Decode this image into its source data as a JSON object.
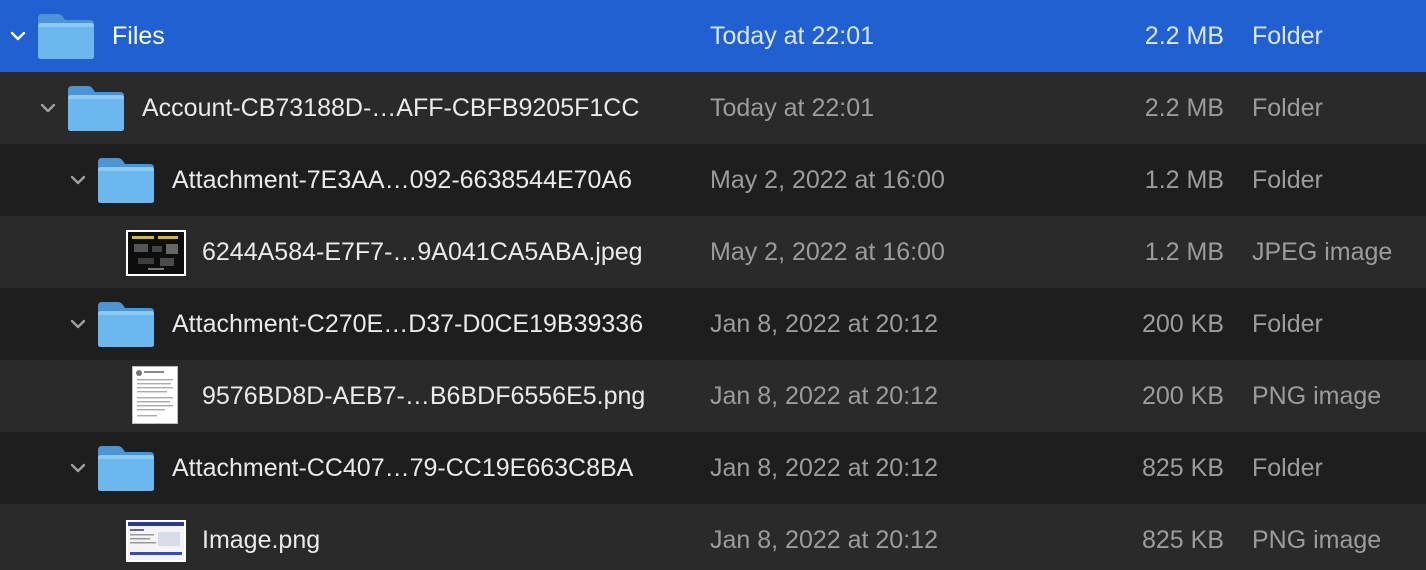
{
  "rows": [
    {
      "name": "Files",
      "date": "Today at 22:01",
      "size": "2.2 MB",
      "kind": "Folder",
      "icon": "folder-icon",
      "expanded": true,
      "selected": true
    },
    {
      "name": "Account-CB73188D-…AFF-CBFB9205F1CC",
      "date": "Today at 22:01",
      "size": "2.2 MB",
      "kind": "Folder",
      "icon": "folder-icon",
      "expanded": true
    },
    {
      "name": "Attachment-7E3AA…092-6638544E70A6",
      "date": "May 2, 2022 at 16:00",
      "size": "1.2 MB",
      "kind": "Folder",
      "icon": "folder-icon",
      "expanded": true
    },
    {
      "name": "6244A584-E7F7-…9A041CA5ABA.jpeg",
      "date": "May 2, 2022 at 16:00",
      "size": "1.2 MB",
      "kind": "JPEG image",
      "icon": "image-thumbnail-icon"
    },
    {
      "name": "Attachment-C270E…D37-D0CE19B39336",
      "date": "Jan 8, 2022 at 20:12",
      "size": "200 KB",
      "kind": "Folder",
      "icon": "folder-icon",
      "expanded": true
    },
    {
      "name": "9576BD8D-AEB7-…B6BDF6556E5.png",
      "date": "Jan 8, 2022 at 20:12",
      "size": "200 KB",
      "kind": "PNG image",
      "icon": "document-thumbnail-icon"
    },
    {
      "name": "Attachment-CC407…79-CC19E663C8BA",
      "date": "Jan 8, 2022 at 20:12",
      "size": "825 KB",
      "kind": "Folder",
      "icon": "folder-icon",
      "expanded": true
    },
    {
      "name": "Image.png",
      "date": "Jan 8, 2022 at 20:12",
      "size": "825 KB",
      "kind": "PNG image",
      "icon": "screenshot-thumbnail-icon"
    }
  ],
  "colors": {
    "selection": "#2160d0",
    "row_alt": "#2a2a2b",
    "row_base": "#1e1e1e",
    "folder": "#5aa8e6",
    "secondary_text": "#9c9c9c"
  }
}
